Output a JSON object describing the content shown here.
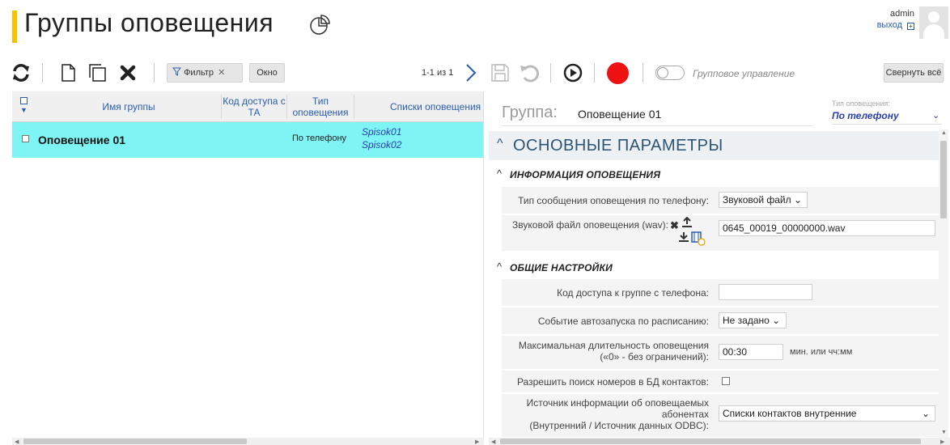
{
  "header": {
    "title": "Группы оповещения",
    "user_name": "admin",
    "logout_label": "выход"
  },
  "toolbar": {
    "filter_label": "Фильтр",
    "filter_close": "✕",
    "window_label": "Окно",
    "pager_text": "1-1 из 1",
    "group_control_label": "Групповое управление",
    "collapse_all_label": "Свернуть всё",
    "group_control_enabled": false
  },
  "grid": {
    "columns": [
      "Имя группы",
      "Код доступа с ТА",
      "Тип оповещения",
      "Списки оповещения"
    ],
    "rows": [
      {
        "name": "Оповещение 01",
        "access_code": "",
        "type": "По телефону",
        "lists": [
          "Spisok01",
          "Spisok02"
        ]
      }
    ],
    "row_highlight_color": "#7ef4f4"
  },
  "panel": {
    "group_label": "Группа:",
    "group_name": "Оповещение 01",
    "type_caption": "Тип оповещения:",
    "type_value": "По телефону",
    "section_main": "ОСНОВНЫЕ ПАРАМЕТРЫ",
    "section_info": "ИНФОРМАЦИЯ ОПОВЕЩЕНИЯ",
    "section_general": "ОБЩИЕ НАСТРОЙКИ",
    "fields": {
      "msg_type_label": "Тип сообщения оповещения по телефону:",
      "msg_type_value": "Звуковой файл",
      "sound_file_label": "Звуковой файл оповещения (wav):",
      "sound_file_value": "0645_00019_00000000.wav",
      "access_code_label": "Код доступа к группе с телефона:",
      "access_code_value": "",
      "autostart_label": "Событие автозапуска по расписанию:",
      "autostart_value": "Не задано",
      "max_duration_label_1": "Максимальная длительность оповещения",
      "max_duration_label_2": "(«0» - без ограничений):",
      "max_duration_value": "00:30",
      "max_duration_unit": "мин. или чч:мм",
      "search_db_label": "Разрешить поиск номеров в БД контактов:",
      "search_db_checked": false,
      "source_label_1": "Источник информации об оповещаемых",
      "source_label_2": "абонентах",
      "source_label_3": "(Внутренний / Источник данных ODBC):",
      "source_value": "Списки контактов внутренние"
    }
  },
  "colors": {
    "accent_yellow": "#f7c200",
    "record_red": "#ee1111",
    "section_blue": "#2b5375",
    "link_blue": "#2a5db0"
  }
}
